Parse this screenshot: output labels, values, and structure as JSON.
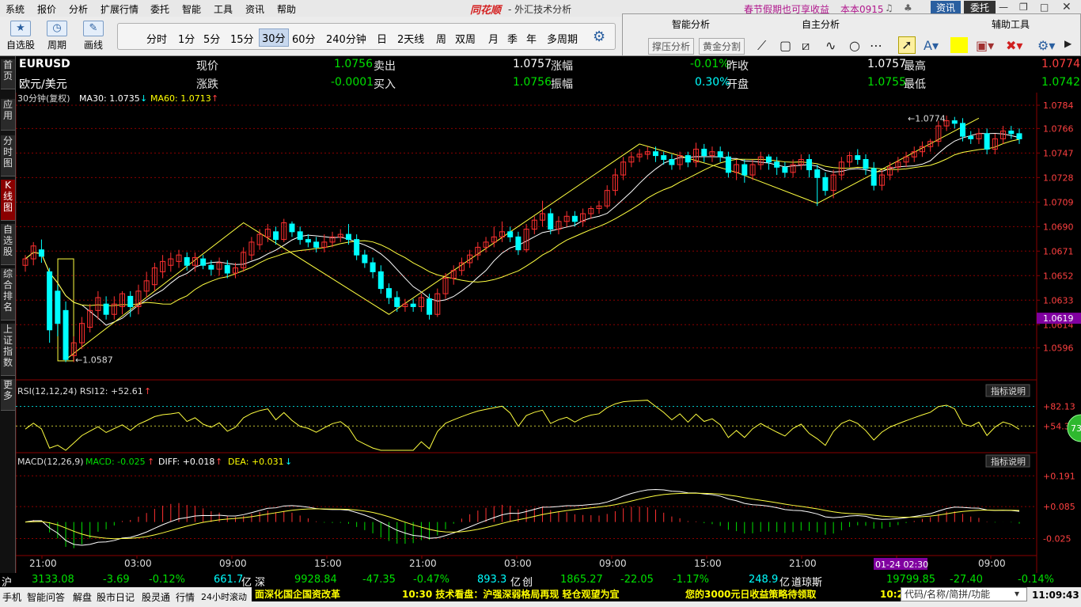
{
  "menu": {
    "items": [
      "系统",
      "报价",
      "分析",
      "扩展行情",
      "委托",
      "智能",
      "工具",
      "资讯",
      "帮助"
    ],
    "logo": "同花顺",
    "window_title": "- 外汇技术分析",
    "promo": "春节假期也可享收益",
    "version": "本本0915",
    "news_btn": "资讯",
    "trade_btn": "委托"
  },
  "toolbar": {
    "buttons": [
      "自选股",
      "周期",
      "画线"
    ],
    "periods": [
      "分时",
      "1分",
      "5分",
      "15分",
      "30分",
      "60分",
      "240分钟",
      "日",
      "2天线",
      "周",
      "双周",
      "月",
      "季",
      "年",
      "多周期"
    ],
    "selected_period": "30分"
  },
  "panel": {
    "headers": [
      "智能分析",
      "自主分析",
      "辅助工具"
    ],
    "buttons": [
      "撑压分析",
      "黄金分割"
    ]
  },
  "sidebar": [
    "首页",
    "应用",
    "分时图",
    "K线图",
    "自选股",
    "综合排名",
    "上证指数",
    "更多"
  ],
  "quote": {
    "symbol": "EURUSD",
    "name": "欧元/美元",
    "cur_label": "现价",
    "cur": "1.0756",
    "chg_label": "涨跌",
    "chg": "-0.0001",
    "sell_label": "卖出",
    "sell": "1.0757",
    "buy_label": "买入",
    "buy": "1.0756",
    "pct_label": "涨幅",
    "pct": "-0.01%",
    "amp_label": "振幅",
    "amp": "0.30%",
    "prev_label": "昨收",
    "prev": "1.0757",
    "open_label": "开盘",
    "open": "1.0755",
    "high_label": "最高",
    "high": "1.0774",
    "low_label": "最低",
    "low": "1.0742"
  },
  "indicators": {
    "ma_label": "30分钟(复权)",
    "ma30": "MA30: 1.0735",
    "ma30_arrow": "↓",
    "ma60": "MA60: 1.0713",
    "ma60_arrow": "↑",
    "rsi": "RSI(12,12,24)  RSI12: +52.61",
    "rsi_arrow": "↑",
    "macd": "MACD(12,26,9)",
    "macd_val": "MACD: -0.025",
    "macd_arrow": "↑",
    "diff": "DIFF: +0.018",
    "diff_arrow": "↑",
    "dea": "DEA: +0.031",
    "dea_arrow": "↓",
    "help": "指标说明",
    "badge": "73"
  },
  "chart_data": {
    "type": "candlestick",
    "price_ticks": [
      "1.0784",
      "1.0766",
      "1.0747",
      "1.0728",
      "1.0709",
      "1.0690",
      "1.0671",
      "1.0652",
      "1.0633",
      "1.0614",
      "1.0596"
    ],
    "price_range": [
      1.0578,
      1.0784
    ],
    "current_price": "1.0619",
    "max_label": "1.0774",
    "min_label": "1.0587",
    "rsi_ticks": [
      "+82.13",
      "+54.39"
    ],
    "macd_ticks": [
      "+0.191",
      "+0.085",
      "-0.025"
    ],
    "time_labels": [
      "21:00",
      "03:00",
      "09:00",
      "15:00",
      "21:00",
      "03:00",
      "09:00",
      "15:00",
      "21:00",
      "03:00",
      "09:00"
    ],
    "cursor_time": "01-24 02:30",
    "candles": [
      [
        1.066,
        1.0665,
        1.0655,
        1.0668
      ],
      [
        1.0665,
        1.0675,
        1.066,
        1.0678
      ],
      [
        1.0672,
        1.0667,
        1.0662,
        1.068
      ],
      [
        1.0655,
        1.061,
        1.06,
        1.0658
      ],
      [
        1.064,
        1.0615,
        1.0605,
        1.0645
      ],
      [
        1.0625,
        1.0587,
        1.0585,
        1.0632
      ],
      [
        1.059,
        1.06,
        1.0585,
        1.0605
      ],
      [
        1.06,
        1.0615,
        1.0595,
        1.062
      ],
      [
        1.0612,
        1.0625,
        1.0608,
        1.063
      ],
      [
        1.0625,
        1.0635,
        1.0618,
        1.064
      ],
      [
        1.063,
        1.0622,
        1.0618,
        1.0636
      ],
      [
        1.0622,
        1.063,
        1.0618,
        1.0636
      ],
      [
        1.0628,
        1.0638,
        1.0622,
        1.064
      ],
      [
        1.0636,
        1.0628,
        1.062,
        1.064
      ],
      [
        1.0628,
        1.064,
        1.0622,
        1.0645
      ],
      [
        1.064,
        1.0648,
        1.0635,
        1.0655
      ],
      [
        1.0645,
        1.0658,
        1.064,
        1.0662
      ],
      [
        1.0655,
        1.0663,
        1.065,
        1.0668
      ],
      [
        1.066,
        1.0665,
        1.0655,
        1.067
      ],
      [
        1.0663,
        1.0668,
        1.0658,
        1.0672
      ],
      [
        1.0666,
        1.066,
        1.0656,
        1.067
      ],
      [
        1.066,
        1.0666,
        1.0655,
        1.067
      ],
      [
        1.0665,
        1.066,
        1.0657,
        1.0668
      ],
      [
        1.066,
        1.0657,
        1.0652,
        1.0664
      ],
      [
        1.0657,
        1.0662,
        1.0652,
        1.0666
      ],
      [
        1.066,
        1.0654,
        1.065,
        1.0664
      ],
      [
        1.0654,
        1.0658,
        1.065,
        1.0662
      ],
      [
        1.0658,
        1.067,
        1.0655,
        1.0674
      ],
      [
        1.0668,
        1.0678,
        1.0664,
        1.0682
      ],
      [
        1.0676,
        1.0684,
        1.0672,
        1.0688
      ],
      [
        1.0682,
        1.0688,
        1.0678,
        1.0692
      ],
      [
        1.0686,
        1.068,
        1.0676,
        1.069
      ],
      [
        1.068,
        1.0693,
        1.0678,
        1.0696
      ],
      [
        1.0692,
        1.0686,
        1.0682,
        1.0694
      ],
      [
        1.0686,
        1.068,
        1.0676,
        1.069
      ],
      [
        1.068,
        1.0678,
        1.0674,
        1.0684
      ],
      [
        1.0678,
        1.0674,
        1.067,
        1.0682
      ],
      [
        1.0674,
        1.0678,
        1.067,
        1.0684
      ],
      [
        1.0678,
        1.0682,
        1.0674,
        1.0686
      ],
      [
        1.0682,
        1.0684,
        1.0678,
        1.0688
      ],
      [
        1.0684,
        1.068,
        1.0676,
        1.0692
      ],
      [
        1.068,
        1.0668,
        1.0664,
        1.0684
      ],
      [
        1.0668,
        1.0662,
        1.0658,
        1.0672
      ],
      [
        1.0662,
        1.0655,
        1.065,
        1.0666
      ],
      [
        1.0655,
        1.0642,
        1.0638,
        1.066
      ],
      [
        1.0642,
        1.0635,
        1.063,
        1.0646
      ],
      [
        1.0635,
        1.0628,
        1.0624,
        1.064
      ],
      [
        1.0628,
        1.063,
        1.0624,
        1.0634
      ],
      [
        1.063,
        1.0628,
        1.0624,
        1.0634
      ],
      [
        1.0628,
        1.0635,
        1.0624,
        1.0638
      ],
      [
        1.0634,
        1.0622,
        1.0618,
        1.0638
      ],
      [
        1.0622,
        1.0638,
        1.062,
        1.0642
      ],
      [
        1.0638,
        1.065,
        1.0634,
        1.0654
      ],
      [
        1.065,
        1.0656,
        1.0645,
        1.066
      ],
      [
        1.0656,
        1.0662,
        1.0652,
        1.0666
      ],
      [
        1.0662,
        1.0668,
        1.0658,
        1.0672
      ],
      [
        1.0668,
        1.0674,
        1.0664,
        1.0678
      ],
      [
        1.0674,
        1.0678,
        1.067,
        1.0682
      ],
      [
        1.0678,
        1.0682,
        1.0674,
        1.069
      ],
      [
        1.0682,
        1.0686,
        1.0678,
        1.0694
      ],
      [
        1.0686,
        1.0682,
        1.0678,
        1.069
      ],
      [
        1.0682,
        1.0672,
        1.0668,
        1.0686
      ],
      [
        1.0672,
        1.0688,
        1.067,
        1.0692
      ],
      [
        1.0688,
        1.0695,
        1.0684,
        1.0698
      ],
      [
        1.0695,
        1.07,
        1.069,
        1.071
      ],
      [
        1.07,
        1.0688,
        1.0684,
        1.0704
      ],
      [
        1.0688,
        1.0694,
        1.0684,
        1.0698
      ],
      [
        1.0694,
        1.0698,
        1.069,
        1.0702
      ],
      [
        1.0698,
        1.0694,
        1.069,
        1.0702
      ],
      [
        1.0694,
        1.07,
        1.069,
        1.0704
      ],
      [
        1.07,
        1.0704,
        1.0696,
        1.0706
      ],
      [
        1.0704,
        1.0706,
        1.07,
        1.071
      ],
      [
        1.0706,
        1.0718,
        1.0704,
        1.0722
      ],
      [
        1.0718,
        1.073,
        1.0714,
        1.0735
      ],
      [
        1.073,
        1.074,
        1.0726,
        1.0744
      ],
      [
        1.074,
        1.0744,
        1.0736,
        1.0748
      ],
      [
        1.0744,
        1.0746,
        1.074,
        1.075
      ],
      [
        1.0746,
        1.0748,
        1.0742,
        1.0752
      ],
      [
        1.0748,
        1.0745,
        1.074,
        1.0752
      ],
      [
        1.0745,
        1.0742,
        1.0738,
        1.0748
      ],
      [
        1.0742,
        1.0738,
        1.0734,
        1.0746
      ],
      [
        1.0738,
        1.0745,
        1.0734,
        1.0748
      ],
      [
        1.0745,
        1.074,
        1.0736,
        1.0748
      ],
      [
        1.074,
        1.075,
        1.0736,
        1.0755
      ],
      [
        1.075,
        1.0745,
        1.074,
        1.0754
      ],
      [
        1.0745,
        1.0748,
        1.074,
        1.0752
      ],
      [
        1.0748,
        1.0744,
        1.074,
        1.0752
      ],
      [
        1.0744,
        1.0732,
        1.0728,
        1.0748
      ],
      [
        1.0732,
        1.0738,
        1.0726,
        1.0742
      ],
      [
        1.0738,
        1.073,
        1.0724,
        1.0742
      ],
      [
        1.073,
        1.0738,
        1.0726,
        1.0742
      ],
      [
        1.0738,
        1.0744,
        1.0734,
        1.0748
      ],
      [
        1.0744,
        1.074,
        1.0734,
        1.0746
      ],
      [
        1.074,
        1.0736,
        1.073,
        1.0744
      ],
      [
        1.0736,
        1.0732,
        1.0728,
        1.074
      ],
      [
        1.0732,
        1.0738,
        1.0728,
        1.0742
      ],
      [
        1.0738,
        1.0742,
        1.0734,
        1.0746
      ],
      [
        1.0742,
        1.0734,
        1.0728,
        1.0746
      ],
      [
        1.0734,
        1.0728,
        1.0706,
        1.0738
      ],
      [
        1.0728,
        1.0718,
        1.0714,
        1.0732
      ],
      [
        1.0718,
        1.073,
        1.0712,
        1.0734
      ],
      [
        1.073,
        1.074,
        1.0726,
        1.0744
      ],
      [
        1.074,
        1.0745,
        1.0736,
        1.0748
      ],
      [
        1.0745,
        1.0742,
        1.0738,
        1.075
      ],
      [
        1.0742,
        1.0735,
        1.073,
        1.0746
      ],
      [
        1.0735,
        1.0722,
        1.0718,
        1.074
      ],
      [
        1.0722,
        1.073,
        1.0718,
        1.0734
      ],
      [
        1.073,
        1.0736,
        1.0726,
        1.074
      ],
      [
        1.0736,
        1.074,
        1.0732,
        1.0744
      ],
      [
        1.074,
        1.0744,
        1.0736,
        1.0748
      ],
      [
        1.0744,
        1.0748,
        1.074,
        1.0752
      ],
      [
        1.0748,
        1.0752,
        1.0744,
        1.0756
      ],
      [
        1.0752,
        1.0756,
        1.0748,
        1.0758
      ],
      [
        1.0756,
        1.0768,
        1.0752,
        1.0772
      ],
      [
        1.0768,
        1.0772,
        1.0764,
        1.0776
      ],
      [
        1.0772,
        1.077,
        1.0766,
        1.0775
      ],
      [
        1.077,
        1.076,
        1.0756,
        1.0774
      ],
      [
        1.076,
        1.0758,
        1.0754,
        1.0764
      ],
      [
        1.0758,
        1.0762,
        1.0754,
        1.0766
      ],
      [
        1.0762,
        1.075,
        1.0746,
        1.0766
      ],
      [
        1.075,
        1.0758,
        1.0746,
        1.0762
      ],
      [
        1.0758,
        1.0764,
        1.0754,
        1.0768
      ],
      [
        1.0764,
        1.0762,
        1.0758,
        1.0768
      ],
      [
        1.0762,
        1.0758,
        1.0754,
        1.0766
      ]
    ]
  },
  "status": {
    "sh": "沪",
    "sh_val": "3133.08",
    "sh_chg": "-3.69",
    "sh_pct": "-0.12%",
    "sh_amt": "661.7",
    "unit": "亿",
    "sz": "深",
    "sz_val": "9928.84",
    "sz_chg": "-47.35",
    "sz_pct": "-0.47%",
    "sz_amt": "893.3",
    "cy": "创",
    "cy_val": "1865.27",
    "cy_chg": "-22.05",
    "cy_pct": "-1.17%",
    "cy_amt": "248.9",
    "dj": "道琼斯",
    "dj_val": "19799.85",
    "dj_chg": "-27.40",
    "dj_pct": "-0.14%"
  },
  "ticker": {
    "items": [
      "手机",
      "智能问答",
      "解盘",
      "股市日记",
      "股灵通",
      "行情",
      "24小时滚动"
    ],
    "news1": "面深化国企国资改革",
    "news2": "10:30 技术看盘：沪强深弱格局再现 轻仓观望为宜",
    "news3": "您的3000元日收益策略待领取",
    "news4": "10:2",
    "search": "代码/名称/简拼/功能",
    "clock": "11:09:43"
  },
  "colors": {
    "up": "#ff3030",
    "down": "#00ffff",
    "ma30": "#ffffff",
    "ma60": "#ffff40",
    "grid": "#8a0000",
    "purple": "#8000a0"
  }
}
